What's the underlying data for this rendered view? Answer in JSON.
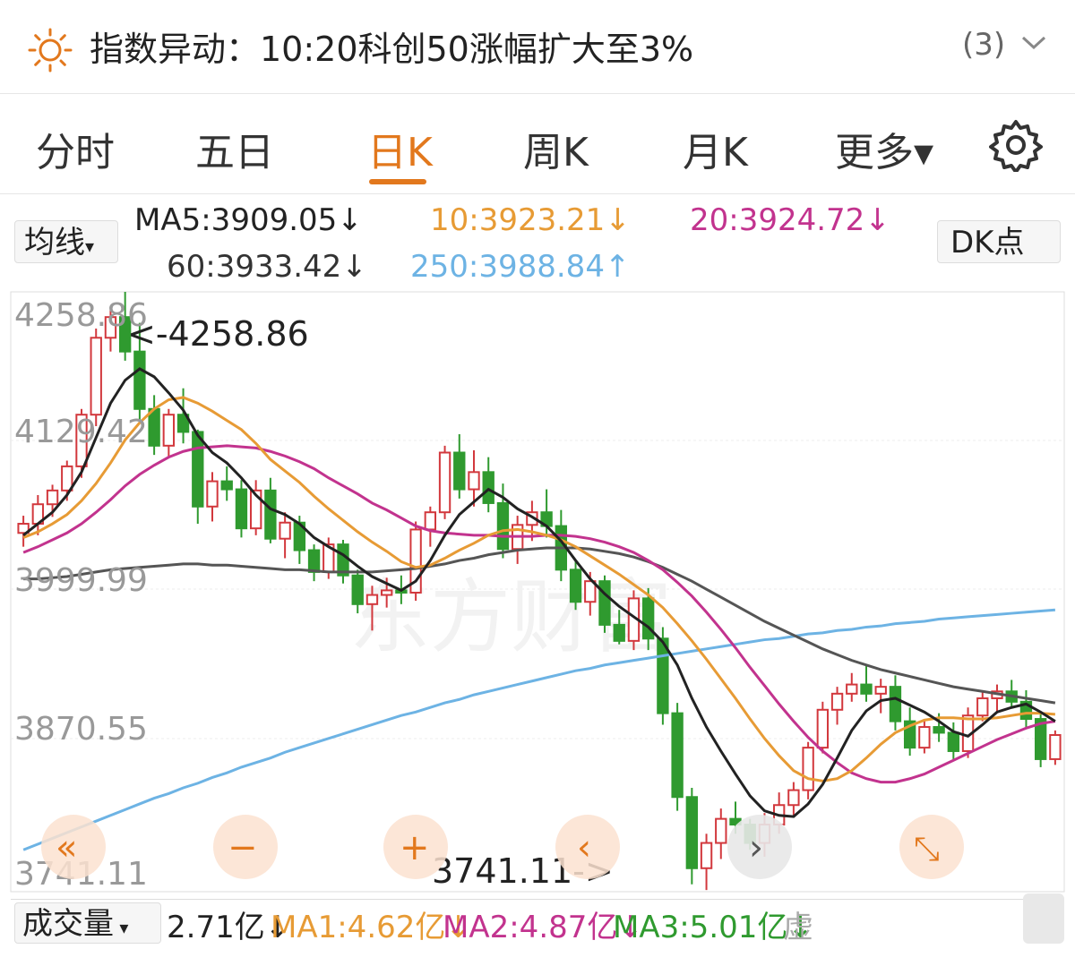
{
  "news": {
    "icon": "sun-icon",
    "headline": "指数异动：10:20科创50涨幅扩大至3%",
    "count": "(3)"
  },
  "tabs": [
    {
      "label": "分时",
      "active": false
    },
    {
      "label": "五日",
      "active": false
    },
    {
      "label": "日K",
      "active": true
    },
    {
      "label": "周K",
      "active": false
    },
    {
      "label": "月K",
      "active": false
    },
    {
      "label": "更多▾",
      "active": false
    }
  ],
  "indicator_select": "均线",
  "dk_button": "DK点",
  "ma_labels": {
    "ma5": "MA5:3909.05↓",
    "ma10": "10:3923.21↓",
    "ma20": "20:3924.72↓",
    "ma60": "60:3933.42↓",
    "ma250": "250:3988.84↑"
  },
  "colors": {
    "accent": "#e2781d",
    "up": "#d2383d",
    "down": "#2f9a2f",
    "ma5": "#222222",
    "ma10": "#e79b35",
    "ma20": "#c2338e",
    "ma60": "#555555",
    "ma250": "#6db3e4"
  },
  "chart_controls": [
    "«",
    "−",
    "+",
    "‹",
    "›",
    "⤡"
  ],
  "watermark": "东方财富",
  "chart_data": {
    "type": "candlestick",
    "y_ticks": [
      "4258.86",
      "4129.42",
      "3999.99",
      "3870.55",
      "3741.11"
    ],
    "ylim": [
      3741.11,
      4258.86
    ],
    "max_label": "<-4258.86",
    "min_label": "3741.11->",
    "max": 4258.86,
    "min": 3741.11,
    "candles": [
      [
        4052,
        4067,
        4040,
        4060
      ],
      [
        4060,
        4085,
        4050,
        4077
      ],
      [
        4077,
        4094,
        4066,
        4089
      ],
      [
        4089,
        4115,
        4080,
        4110
      ],
      [
        4110,
        4160,
        4100,
        4155
      ],
      [
        4155,
        4230,
        4145,
        4222
      ],
      [
        4222,
        4248,
        4210,
        4240
      ],
      [
        4240,
        4262,
        4202,
        4210
      ],
      [
        4210,
        4235,
        4150,
        4160
      ],
      [
        4160,
        4172,
        4120,
        4128
      ],
      [
        4128,
        4160,
        4118,
        4155
      ],
      [
        4155,
        4178,
        4130,
        4140
      ],
      [
        4140,
        4142,
        4060,
        4075
      ],
      [
        4075,
        4105,
        4062,
        4097
      ],
      [
        4097,
        4110,
        4080,
        4090
      ],
      [
        4090,
        4098,
        4048,
        4056
      ],
      [
        4056,
        4098,
        4050,
        4089
      ],
      [
        4089,
        4100,
        4043,
        4047
      ],
      [
        4047,
        4070,
        4030,
        4061
      ],
      [
        4061,
        4067,
        4025,
        4037
      ],
      [
        4037,
        4042,
        4010,
        4018
      ],
      [
        4018,
        4048,
        4012,
        4042
      ],
      [
        4042,
        4046,
        4008,
        4015
      ],
      [
        4015,
        4020,
        3982,
        3990
      ],
      [
        3990,
        4006,
        3967,
        3998
      ],
      [
        3998,
        4013,
        3987,
        4002
      ],
      [
        4002,
        4015,
        3990,
        4000
      ],
      [
        4000,
        4062,
        3993,
        4055
      ],
      [
        4055,
        4075,
        4040,
        4070
      ],
      [
        4070,
        4128,
        4064,
        4122
      ],
      [
        4122,
        4138,
        4082,
        4090
      ],
      [
        4090,
        4124,
        4075,
        4105
      ],
      [
        4105,
        4118,
        4070,
        4078
      ],
      [
        4078,
        4095,
        4030,
        4038
      ],
      [
        4038,
        4067,
        4025,
        4059
      ],
      [
        4059,
        4080,
        4045,
        4070
      ],
      [
        4070,
        4090,
        4048,
        4058
      ],
      [
        4058,
        4072,
        4010,
        4020
      ],
      [
        4020,
        4028,
        3985,
        3992
      ],
      [
        3992,
        4018,
        3980,
        4010
      ],
      [
        4010,
        4015,
        3965,
        3972
      ],
      [
        3972,
        3985,
        3955,
        3958
      ],
      [
        3958,
        4002,
        3950,
        3995
      ],
      [
        3995,
        4004,
        3950,
        3960
      ],
      [
        3960,
        3970,
        3885,
        3895
      ],
      [
        3895,
        3904,
        3810,
        3822
      ],
      [
        3822,
        3830,
        3746,
        3760
      ],
      [
        3760,
        3790,
        3741,
        3782
      ],
      [
        3782,
        3812,
        3768,
        3803
      ],
      [
        3803,
        3818,
        3790,
        3798
      ],
      [
        3798,
        3803,
        3776,
        3782
      ],
      [
        3782,
        3808,
        3770,
        3798
      ],
      [
        3798,
        3826,
        3790,
        3815
      ],
      [
        3815,
        3835,
        3805,
        3828
      ],
      [
        3828,
        3870,
        3820,
        3865
      ],
      [
        3865,
        3905,
        3860,
        3898
      ],
      [
        3898,
        3918,
        3885,
        3912
      ],
      [
        3912,
        3930,
        3905,
        3920
      ],
      [
        3920,
        3936,
        3905,
        3912
      ],
      [
        3912,
        3925,
        3895,
        3918
      ],
      [
        3918,
        3928,
        3880,
        3888
      ],
      [
        3888,
        3900,
        3858,
        3865
      ],
      [
        3865,
        3890,
        3860,
        3883
      ],
      [
        3883,
        3895,
        3870,
        3878
      ],
      [
        3878,
        3887,
        3855,
        3862
      ],
      [
        3862,
        3900,
        3856,
        3893
      ],
      [
        3893,
        3915,
        3888,
        3908
      ],
      [
        3908,
        3920,
        3895,
        3914
      ],
      [
        3914,
        3924,
        3900,
        3905
      ],
      [
        3905,
        3915,
        3882,
        3890
      ],
      [
        3890,
        3896,
        3848,
        3855
      ],
      [
        3855,
        3880,
        3850,
        3876
      ]
    ],
    "ma5": [
      4050,
      4060,
      4070,
      4085,
      4105,
      4135,
      4165,
      4185,
      4195,
      4188,
      4174,
      4159,
      4137,
      4122,
      4113,
      4100,
      4085,
      4073,
      4068,
      4060,
      4048,
      4040,
      4033,
      4023,
      4014,
      4008,
      4002,
      4010,
      4028,
      4050,
      4068,
      4079,
      4090,
      4083,
      4073,
      4066,
      4058,
      4045,
      4028,
      4012,
      3999,
      3988,
      3979,
      3970,
      3957,
      3937,
      3908,
      3883,
      3862,
      3842,
      3823,
      3810,
      3806,
      3805,
      3816,
      3833,
      3856,
      3880,
      3897,
      3906,
      3908,
      3902,
      3896,
      3888,
      3879,
      3875,
      3885,
      3896,
      3900,
      3903,
      3896,
      3888
    ],
    "ma10": [
      4048,
      4053,
      4060,
      4068,
      4080,
      4095,
      4113,
      4133,
      4148,
      4160,
      4168,
      4170,
      4165,
      4158,
      4150,
      4142,
      4130,
      4116,
      4106,
      4096,
      4084,
      4073,
      4063,
      4053,
      4044,
      4036,
      4027,
      4022,
      4024,
      4030,
      4037,
      4043,
      4050,
      4054,
      4055,
      4053,
      4050,
      4046,
      4040,
      4032,
      4024,
      4016,
      4007,
      3998,
      3987,
      3973,
      3958,
      3942,
      3925,
      3908,
      3890,
      3873,
      3858,
      3845,
      3838,
      3836,
      3838,
      3845,
      3856,
      3868,
      3878,
      3884,
      3889,
      3891,
      3891,
      3890,
      3890,
      3891,
      3893,
      3895,
      3895,
      3894
    ],
    "ma20": [
      4035,
      4040,
      4046,
      4052,
      4060,
      4070,
      4081,
      4093,
      4103,
      4111,
      4118,
      4123,
      4126,
      4127,
      4128,
      4127,
      4126,
      4123,
      4119,
      4114,
      4108,
      4100,
      4093,
      4086,
      4078,
      4072,
      4065,
      4058,
      4054,
      4052,
      4051,
      4050,
      4050,
      4049,
      4049,
      4049,
      4050,
      4050,
      4049,
      4047,
      4044,
      4040,
      4035,
      4028,
      4020,
      4009,
      3997,
      3983,
      3968,
      3952,
      3935,
      3919,
      3903,
      3888,
      3874,
      3862,
      3852,
      3843,
      3838,
      3835,
      3835,
      3838,
      3842,
      3848,
      3854,
      3860,
      3866,
      3872,
      3877,
      3882,
      3886,
      3888
    ],
    "ma60": [
      4012,
      4012,
      4013,
      4014,
      4016,
      4018,
      4020,
      4021,
      4022,
      4023,
      4024,
      4025,
      4025,
      4024,
      4024,
      4023,
      4022,
      4021,
      4020,
      4020,
      4019,
      4018,
      4018,
      4018,
      4018,
      4019,
      4020,
      4021,
      4023,
      4025,
      4028,
      4030,
      4033,
      4035,
      4037,
      4038,
      4039,
      4039,
      4039,
      4038,
      4036,
      4034,
      4031,
      4027,
      4022,
      4016,
      4010,
      4003,
      3996,
      3989,
      3982,
      3975,
      3969,
      3963,
      3957,
      3951,
      3946,
      3941,
      3937,
      3933,
      3930,
      3927,
      3924,
      3921,
      3918,
      3916,
      3914,
      3912,
      3910,
      3908,
      3906,
      3904
    ],
    "ma250": [
      3776,
      3781,
      3786,
      3791,
      3796,
      3801,
      3806,
      3811,
      3816,
      3821,
      3825,
      3830,
      3834,
      3839,
      3843,
      3848,
      3852,
      3856,
      3861,
      3865,
      3869,
      3873,
      3877,
      3881,
      3885,
      3889,
      3893,
      3896,
      3900,
      3904,
      3907,
      3911,
      3914,
      3917,
      3920,
      3923,
      3926,
      3929,
      3932,
      3934,
      3937,
      3939,
      3941,
      3943,
      3945,
      3947,
      3949,
      3951,
      3953,
      3955,
      3957,
      3959,
      3960,
      3962,
      3964,
      3965,
      3967,
      3968,
      3970,
      3971,
      3973,
      3974,
      3975,
      3977,
      3978,
      3979,
      3980,
      3981,
      3982,
      3983,
      3984,
      3985
    ]
  },
  "volume": {
    "selector": "成交量",
    "value": "2.71亿↓",
    "ma1": "MA1:4.62亿↓",
    "ma2": "MA2:4.87亿↓",
    "ma3": "MA3:5.01亿↓",
    "extra": "虚"
  }
}
